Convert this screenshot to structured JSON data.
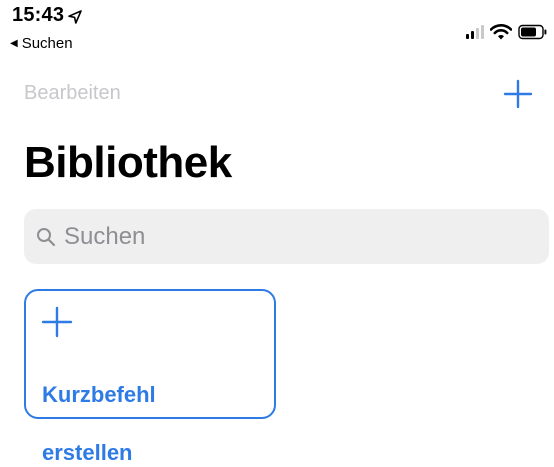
{
  "status_bar": {
    "time": "15:43",
    "location_icon": "location-arrow-icon",
    "back_label": "Suchen",
    "back_icon": "back-triangle-icon",
    "signal_bars": 4,
    "signal_bars_filled": 2,
    "wifi": true,
    "battery": "battery-icon"
  },
  "nav": {
    "edit_label": "Bearbeiten",
    "add_icon": "plus-icon"
  },
  "page": {
    "title": "Bibliothek"
  },
  "search": {
    "icon": "search-icon",
    "placeholder": "Suchen"
  },
  "create_card": {
    "icon": "plus-icon",
    "label_line1": "Kurzbefehl",
    "label_line2": "erstellen"
  },
  "colors": {
    "accent": "#2f7be6",
    "disabled_text": "#c7c7cc",
    "search_bg": "#efeff0",
    "placeholder": "#8e8e93"
  }
}
